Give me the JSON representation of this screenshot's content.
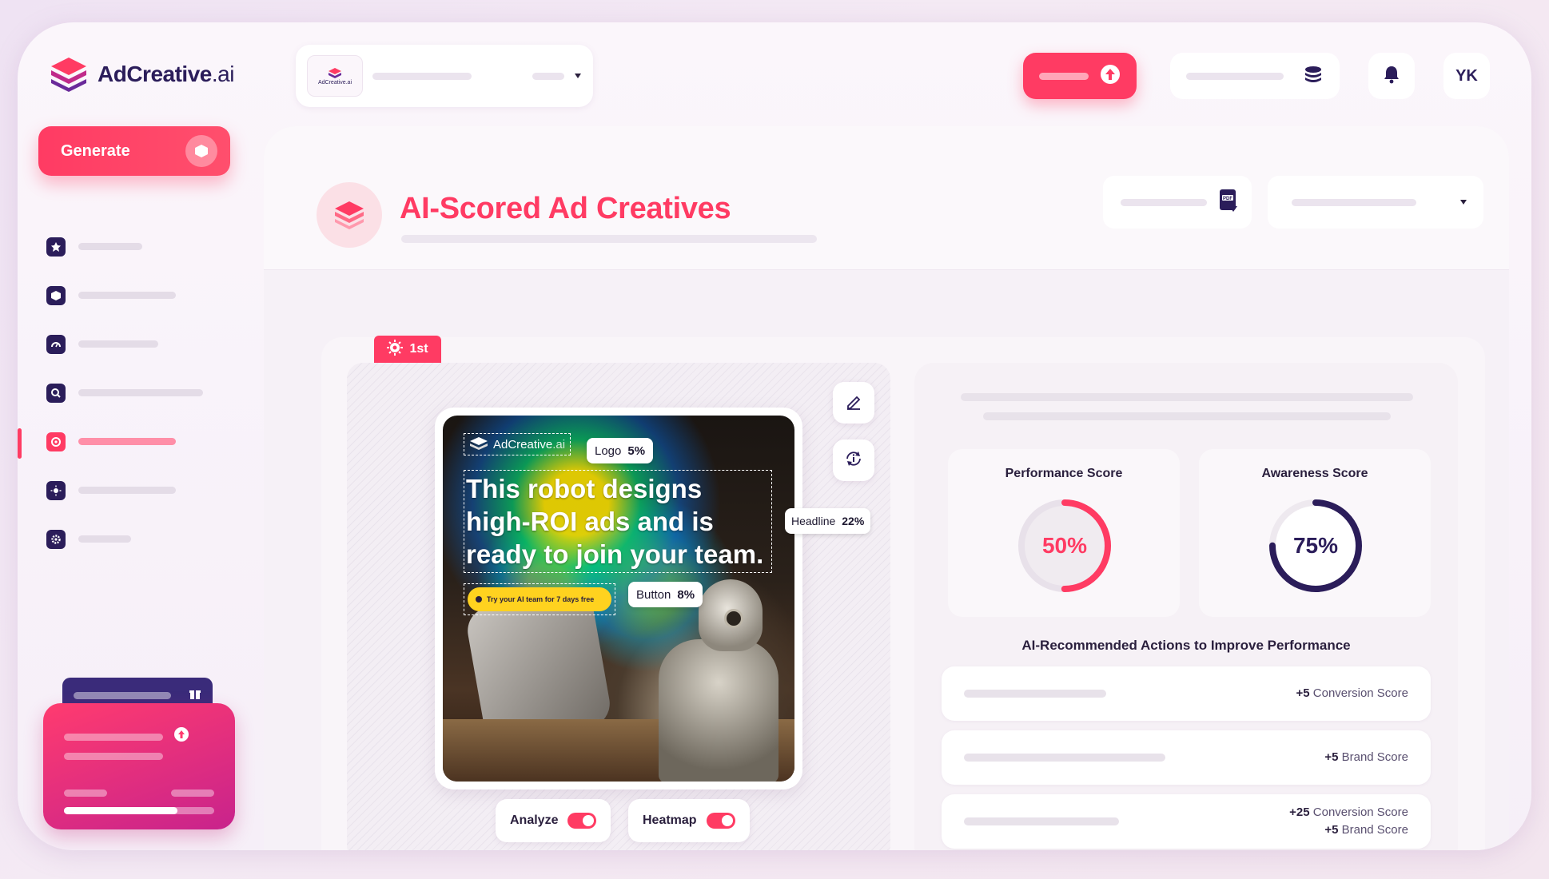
{
  "brand": {
    "name_main": "AdCreative",
    "name_suffix": ".ai",
    "accent": "#ff3b63",
    "navy": "#2b1d5a"
  },
  "sidebar": {
    "generate_label": "Generate",
    "items": [
      {
        "icon": "star-icon"
      },
      {
        "icon": "cube-icon"
      },
      {
        "icon": "gauge-icon"
      },
      {
        "icon": "search-icon"
      },
      {
        "icon": "target-icon",
        "active": true
      },
      {
        "icon": "sun-icon"
      },
      {
        "icon": "gear-icon"
      }
    ]
  },
  "topbar": {
    "workspace_logo_text": "AdCreative.ai",
    "avatar_initials": "YK"
  },
  "page": {
    "title": "AI-Scored Ad Creatives",
    "rank_label": "1st",
    "pdf_label": "PDF"
  },
  "ad": {
    "logo_text_main": "AdCreative",
    "logo_text_suffix": ".ai",
    "headline": "This robot designs high-ROI ads and is ready to join your team.",
    "cta_text": "Try your AI team for 7 days free",
    "tags": {
      "logo": {
        "label": "Logo",
        "value": "5%"
      },
      "headline": {
        "label": "Headline",
        "value": "22%"
      },
      "button": {
        "label": "Button",
        "value": "8%"
      }
    }
  },
  "toggles": {
    "analyze": "Analyze",
    "heatmap": "Heatmap"
  },
  "scores": {
    "performance": {
      "label": "Performance Score",
      "value": "50%",
      "fraction": 0.5,
      "color": "#ff3b63"
    },
    "awareness": {
      "label": "Awareness Score",
      "value": "75%",
      "fraction": 0.75,
      "color": "#2b1d5a"
    }
  },
  "actions": {
    "title": "AI-Recommended Actions to Improve Performance",
    "items": [
      {
        "lines": [
          {
            "delta": "+5",
            "label": "Conversion Score"
          }
        ]
      },
      {
        "lines": [
          {
            "delta": "+5",
            "label": "Brand Score"
          }
        ]
      },
      {
        "lines": [
          {
            "delta": "+25",
            "label": "Conversion Score"
          },
          {
            "delta": "+5",
            "label": "Brand Score"
          }
        ]
      }
    ]
  }
}
